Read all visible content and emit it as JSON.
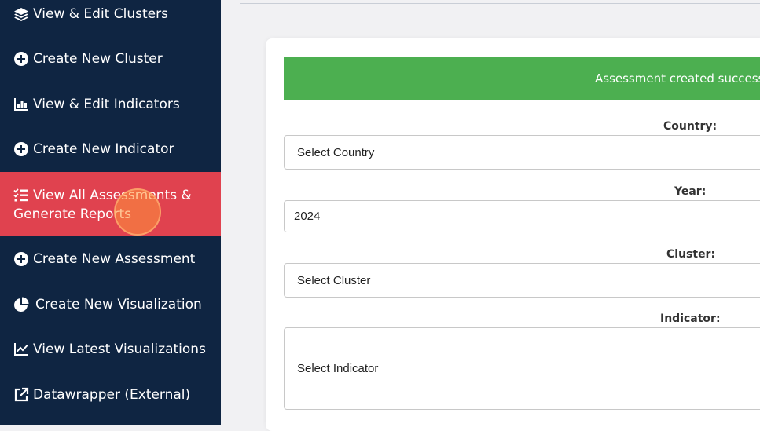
{
  "sidebar": {
    "items": [
      {
        "label": "View & Edit Clusters",
        "icon": "layers-icon"
      },
      {
        "label": "Create New Cluster",
        "icon": "plus-circle-icon"
      },
      {
        "label": "View & Edit Indicators",
        "icon": "bar-chart-icon"
      },
      {
        "label": "Create New Indicator",
        "icon": "plus-circle-icon"
      },
      {
        "label": "View All Assessments & Generate Reports",
        "icon": "checklist-icon",
        "active": true
      },
      {
        "label": "Create New Assessment",
        "icon": "plus-circle-icon"
      },
      {
        "label": "Create New Visualization",
        "icon": "pie-chart-icon"
      },
      {
        "label": "View Latest Visualizations",
        "icon": "line-chart-icon"
      },
      {
        "label": "Datawrapper (External)",
        "icon": "external-link-icon"
      }
    ],
    "active_line1": "View All Assessments &",
    "active_line2": "Generate Reports",
    "background_color": "#0f2542",
    "active_color": "#e0424f"
  },
  "alert": {
    "text": "Assessment created successfully",
    "color": "#4caf50"
  },
  "form": {
    "country": {
      "label": "Country:",
      "value": "Select Country"
    },
    "year": {
      "label": "Year:",
      "value": "2024"
    },
    "cluster": {
      "label": "Cluster:",
      "value": "Select Cluster"
    },
    "indicator": {
      "label": "Indicator:",
      "value": "Select Indicator"
    }
  }
}
